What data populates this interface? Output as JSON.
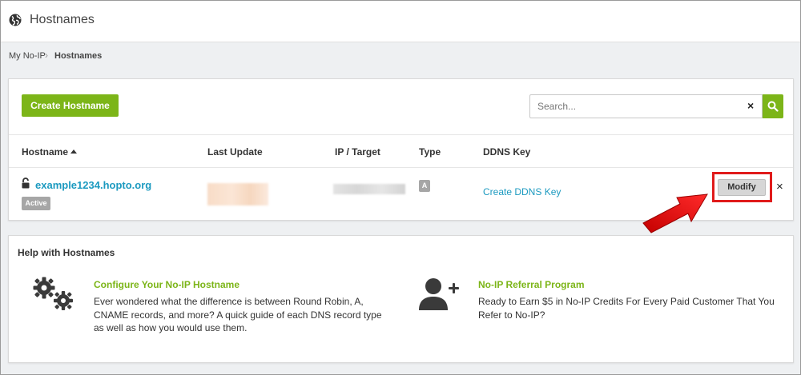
{
  "header": {
    "title": "Hostnames",
    "icon": "globe-icon"
  },
  "breadcrumb": {
    "items": [
      "My No-IP",
      "Hostnames"
    ]
  },
  "toolbar": {
    "create_label": "Create Hostname",
    "search_placeholder": "Search...",
    "search_clear": "×"
  },
  "table": {
    "headers": [
      "Hostname",
      "Last Update",
      "IP / Target",
      "Type",
      "DDNS Key"
    ],
    "sort_column": "Hostname",
    "rows": [
      {
        "hostname": "example1234.hopto.org",
        "status": "Active",
        "type": "A",
        "ddns_key": "Create DDNS Key",
        "modify_label": "Modify",
        "delete_label": "×"
      }
    ]
  },
  "help": {
    "title": "Help with Hostnames",
    "cards": [
      {
        "icon": "gears-icon",
        "heading": "Configure Your No-IP Hostname",
        "text": "Ever wondered what the difference is between Round Robin, A, CNAME records, and more? A quick guide of each DNS record type as well as how you would use them."
      },
      {
        "icon": "user-plus-icon",
        "heading": "No-IP Referral Program",
        "text": "Ready to Earn $5 in No-IP Credits For Every Paid Customer That You Refer to No-IP?"
      }
    ]
  },
  "colors": {
    "accent": "#7cb518",
    "link": "#1c9ac0",
    "highlight": "#e01b1b"
  }
}
